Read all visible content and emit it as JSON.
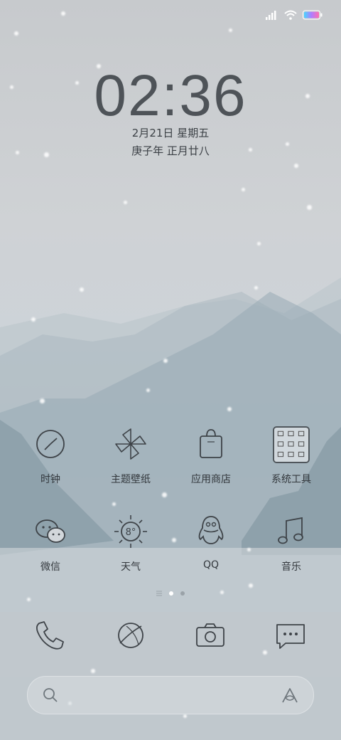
{
  "status_bar": {
    "signal_icon": "signal-icon",
    "wifi_icon": "wifi-icon",
    "battery_icon": "battery-icon"
  },
  "lockscreen": {
    "time": "02:36",
    "date": "2月21日 星期五",
    "lunar": "庚子年 正月廿八"
  },
  "apps": [
    {
      "label": "时钟",
      "icon": "clock-icon"
    },
    {
      "label": "主题壁纸",
      "icon": "theme-icon"
    },
    {
      "label": "应用商店",
      "icon": "store-bag-icon"
    },
    {
      "label": "系统工具",
      "icon": "folder-icon"
    },
    {
      "label": "微信",
      "icon": "wechat-icon"
    },
    {
      "label": "天气",
      "icon": "weather-sun-icon"
    },
    {
      "label": "QQ",
      "icon": "qq-penguin-icon"
    },
    {
      "label": "音乐",
      "icon": "music-note-icon"
    }
  ],
  "weather_temp": "8°",
  "page_indicator": {
    "pages": 3,
    "current": 2
  },
  "dock": [
    {
      "icon": "phone-icon"
    },
    {
      "icon": "browser-icon"
    },
    {
      "icon": "camera-icon"
    },
    {
      "icon": "messages-icon"
    }
  ],
  "search_bar": {
    "search_icon": "search-icon",
    "assistant_icon": "assistant-icon"
  }
}
